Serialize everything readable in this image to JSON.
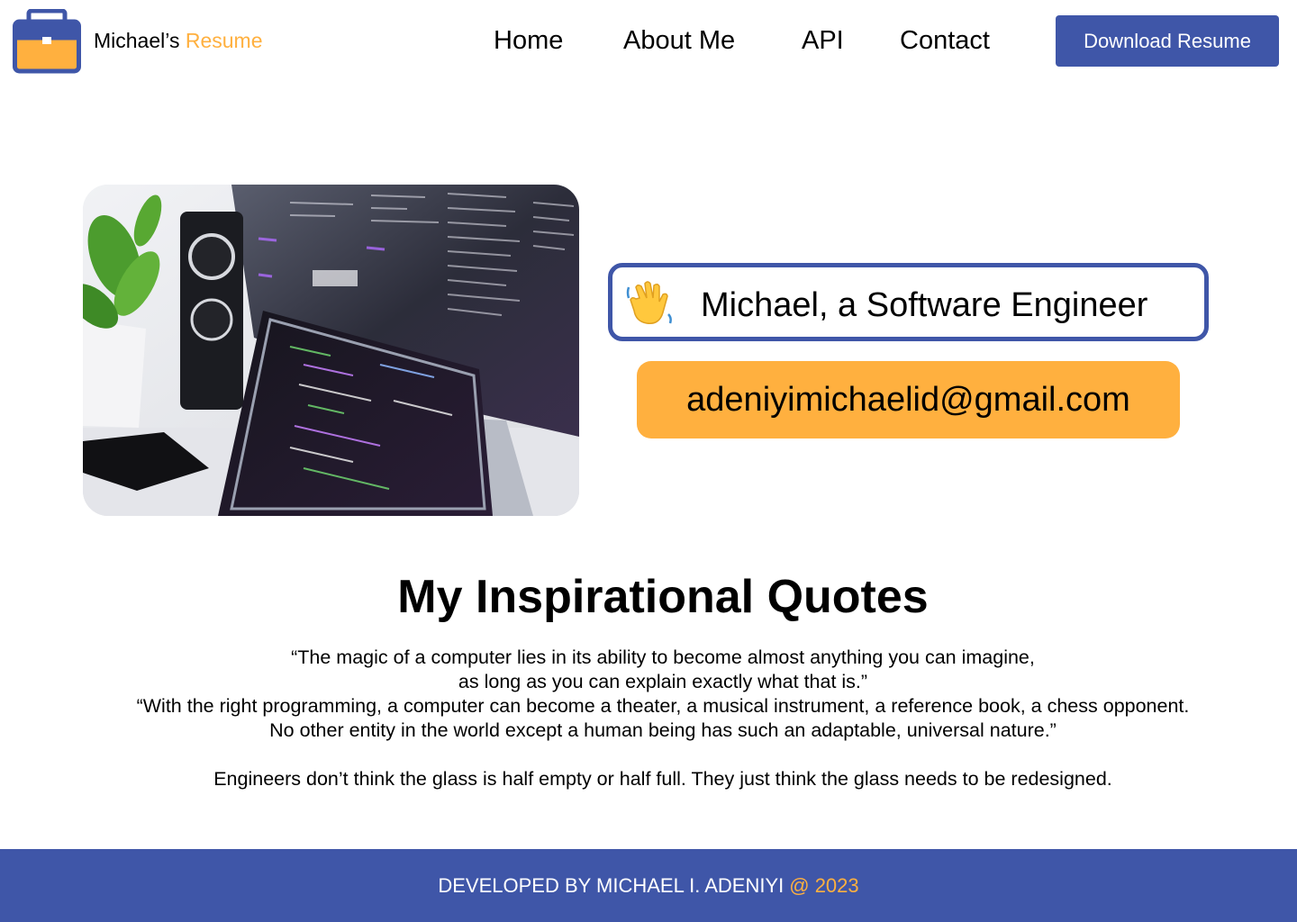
{
  "header": {
    "brand_name": "Michael’s",
    "brand_accent": "Resume",
    "logo_icon": "briefcase-icon",
    "nav": [
      "Home",
      "About Me",
      "API",
      "Contact"
    ],
    "download_label": "Download Resume"
  },
  "hero": {
    "image_icon": "workspace-photo",
    "intro_icon": "waving-hand-icon",
    "intro_text": "Michael, a Software Engineer",
    "email": "adeniyimichaelid@gmail.com"
  },
  "quotes": {
    "heading": "My Inspirational Quotes",
    "lines": [
      "“The magic of a computer lies in its ability to become almost anything you can imagine,",
      "as long as you can explain exactly what that is.”",
      "“With the right programming, a computer can become a theater, a musical instrument, a reference book, a chess opponent.",
      "No other entity in the world except a human being has such an adaptable, universal nature.”",
      "Engineers don’t think the glass is half empty or half full. They just think the glass needs to be redesigned."
    ]
  },
  "footer": {
    "text": "DEVELOPED BY MICHAEL I. ADENIYI",
    "accent": "@ 2023"
  },
  "colors": {
    "primary_blue": "#3f56a8",
    "accent_orange": "#ffb03f"
  }
}
